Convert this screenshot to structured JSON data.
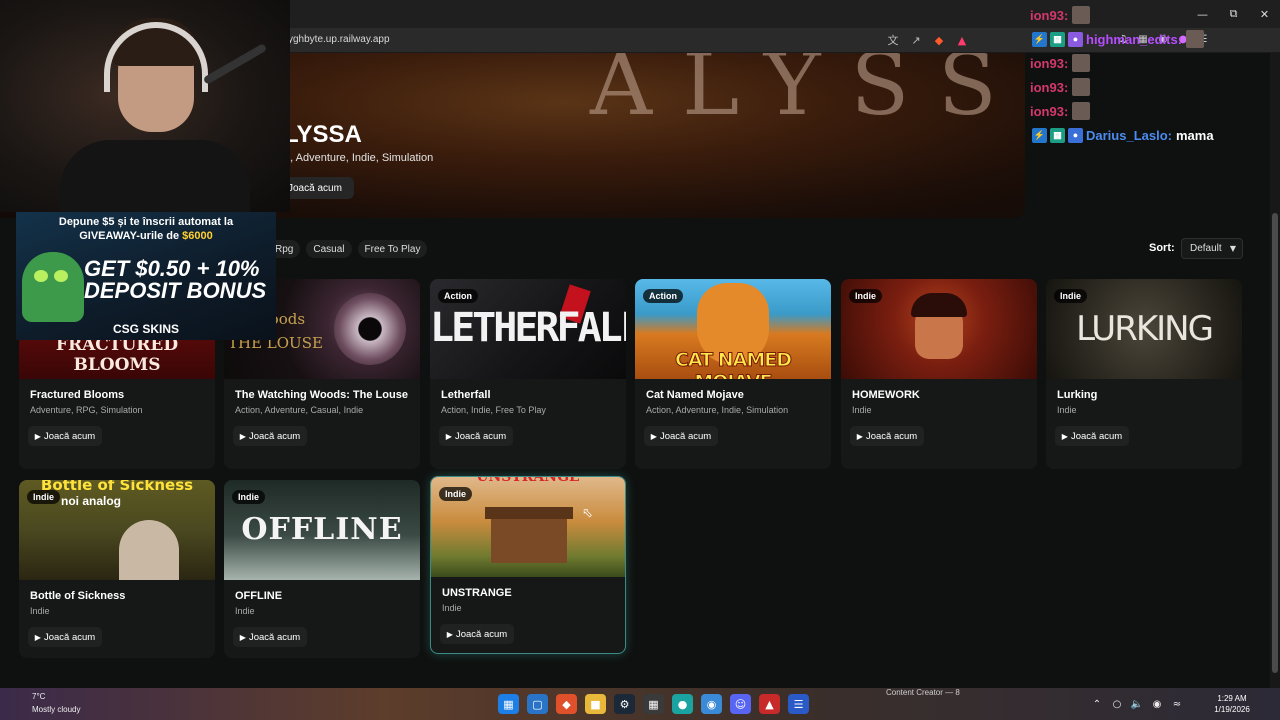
{
  "browser": {
    "url": "yghbyte.up.railway.app",
    "window_controls": [
      "minimize-icon",
      "restore-icon",
      "close-icon"
    ]
  },
  "hero": {
    "art_text": "ALYSSA",
    "title": "LYSSA",
    "tags": "a, Adventure, Indie, Simulation",
    "play_label": "Joacă acum"
  },
  "filters": {
    "chips": [
      "Rpg",
      "Casual",
      "Free To Play"
    ],
    "sort_label": "Sort:",
    "sort_value": "Default"
  },
  "chat": {
    "messages": [
      {
        "user": "ion93:",
        "message": "",
        "color": "#d4386b"
      },
      {
        "user": "highman_edits:",
        "message": "",
        "color": "#b74dff"
      },
      {
        "user": "ion93:",
        "message": "",
        "color": "#d4386b"
      },
      {
        "user": "ion93:",
        "message": "",
        "color": "#d4386b"
      },
      {
        "user": "ion93:",
        "message": "",
        "color": "#d4386b"
      },
      {
        "user": "Darius_Laslo:",
        "message": "mama",
        "color": "#4b8cf0"
      }
    ]
  },
  "ad": {
    "line1_prefix": "Depune $5 și te înscrii automat la",
    "line2_prefix": "GIVEAWAY-urile de",
    "line2_amount": "$6000",
    "bonus_line1": "GET $0.50 + 10%",
    "bonus_line2": "DEPOSIT BONUS",
    "brand": "CSG SKINS"
  },
  "play_label": "Joacă acum",
  "games": [
    {
      "title": "Fractured Blooms",
      "tags": "Adventure, RPG, Simulation",
      "badge": "",
      "thumb_text": "FRACTURED BLOOMS",
      "thumb_color": "#5a0b0b"
    },
    {
      "title": "The Watching Woods: The Louse",
      "tags": "Action, Adventure, Casual, Indie",
      "badge": "",
      "thumb_text": "ing woods THE LOUSE",
      "thumb_color": "#1b1514"
    },
    {
      "title": "Letherfall",
      "tags": "Action, Indie, Free To Play",
      "badge": "Action",
      "thumb_text": "LETHERFALL",
      "thumb_color": "#1a1a1c"
    },
    {
      "title": "Cat Named Mojave",
      "tags": "Action, Adventure, Indie, Simulation",
      "badge": "Action",
      "thumb_text": "CAT NAMED MOJAVE",
      "thumb_color": "#c86a1a"
    },
    {
      "title": "HOMEWORK",
      "tags": "Indie",
      "badge": "Indie",
      "thumb_text": "",
      "thumb_color": "#6d1e10"
    },
    {
      "title": "Lurking",
      "tags": "Indie",
      "badge": "Indie",
      "thumb_text": "LURKING",
      "thumb_color": "#2d2a22"
    },
    {
      "title": "Bottle of Sickness",
      "tags": "Indie",
      "badge": "Indie",
      "thumb_text": "Bottle of Sickness",
      "thumb_sub": "noi analog",
      "thumb_color": "#4a4820"
    },
    {
      "title": "OFFLINE",
      "tags": "Indie",
      "badge": "Indie",
      "thumb_text": "OFFLINE",
      "thumb_color": "#2f3a34"
    },
    {
      "title": "UNSTRANGE",
      "tags": "Indie",
      "badge": "Indie",
      "thumb_text": "UNSTRANGE",
      "thumb_color": "#b9742d"
    }
  ],
  "taskbar": {
    "weather_temp": "7°C",
    "weather_desc": "Mostly cloudy",
    "content_creator": "Content Creator — 8",
    "time": "1:29 AM",
    "date": "1/19/2026"
  }
}
